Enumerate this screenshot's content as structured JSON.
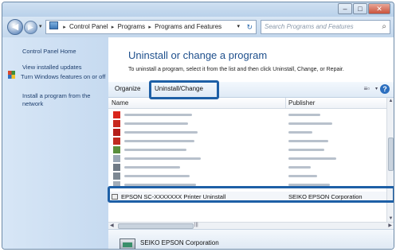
{
  "window": {
    "caption": {
      "minimize": "–",
      "maximize": "□",
      "close": "✕"
    }
  },
  "navigation": {
    "back_glyph": "◀",
    "forward_glyph": "▶",
    "dropdown_glyph": "▾"
  },
  "address": {
    "segments": [
      "Control Panel",
      "Programs",
      "Programs and Features"
    ],
    "separator": "▸",
    "dropdown_glyph": "▾",
    "refresh_glyph": "↻"
  },
  "search": {
    "placeholder": "Search Programs and Features",
    "icon_glyph": "⌕"
  },
  "sidebar": {
    "items": [
      {
        "label": "Control Panel Home"
      },
      {
        "label": "View installed updates"
      },
      {
        "label": "Turn Windows features on or off"
      },
      {
        "label": "Install a program from the network"
      }
    ]
  },
  "main": {
    "heading": "Uninstall or change a program",
    "subtext": "To uninstall a program, select it from the list and then click Uninstall, Change, or Repair."
  },
  "toolbar": {
    "organize_label": "Organize",
    "uninstall_change_label": "Uninstall/Change",
    "view_icons_glyph": "≡▫",
    "view_dropdown_glyph": "▾",
    "help_glyph": "?"
  },
  "columns": {
    "name": "Name",
    "publisher": "Publisher"
  },
  "list": {
    "blurred_rows": [
      {
        "icon": "acrobat-icon",
        "icon_color": "#d9261c"
      },
      {
        "icon": "red-app-icon",
        "icon_color": "#c8281e"
      },
      {
        "icon": "red-app-icon",
        "icon_color": "#b51f1a"
      },
      {
        "icon": "red-app-icon",
        "icon_color": "#c02a20"
      },
      {
        "icon": "green-app-icon",
        "icon_color": "#5a8f3c"
      },
      {
        "icon": "document-icon",
        "icon_color": "#9aa7b5"
      },
      {
        "icon": "gray-app-icon",
        "icon_color": "#6f7a85"
      },
      {
        "icon": "gray-app-icon",
        "icon_color": "#7d8893"
      },
      {
        "icon": "document-icon",
        "icon_color": "#a3adb8"
      }
    ],
    "selected_row": {
      "name": "EPSON SC-XXXXXXX Printer Uninstall",
      "publisher": "SEIKO EPSON Corporation"
    }
  },
  "scrollbars": {
    "up": "▲",
    "down": "▼",
    "left": "◀",
    "right": "▶",
    "grip": "|||"
  },
  "details": {
    "publisher": "SEIKO EPSON Corporation"
  },
  "colors": {
    "callout": "#1d5fa6",
    "heading": "#1e4f8c",
    "link": "#1e3f6e"
  }
}
